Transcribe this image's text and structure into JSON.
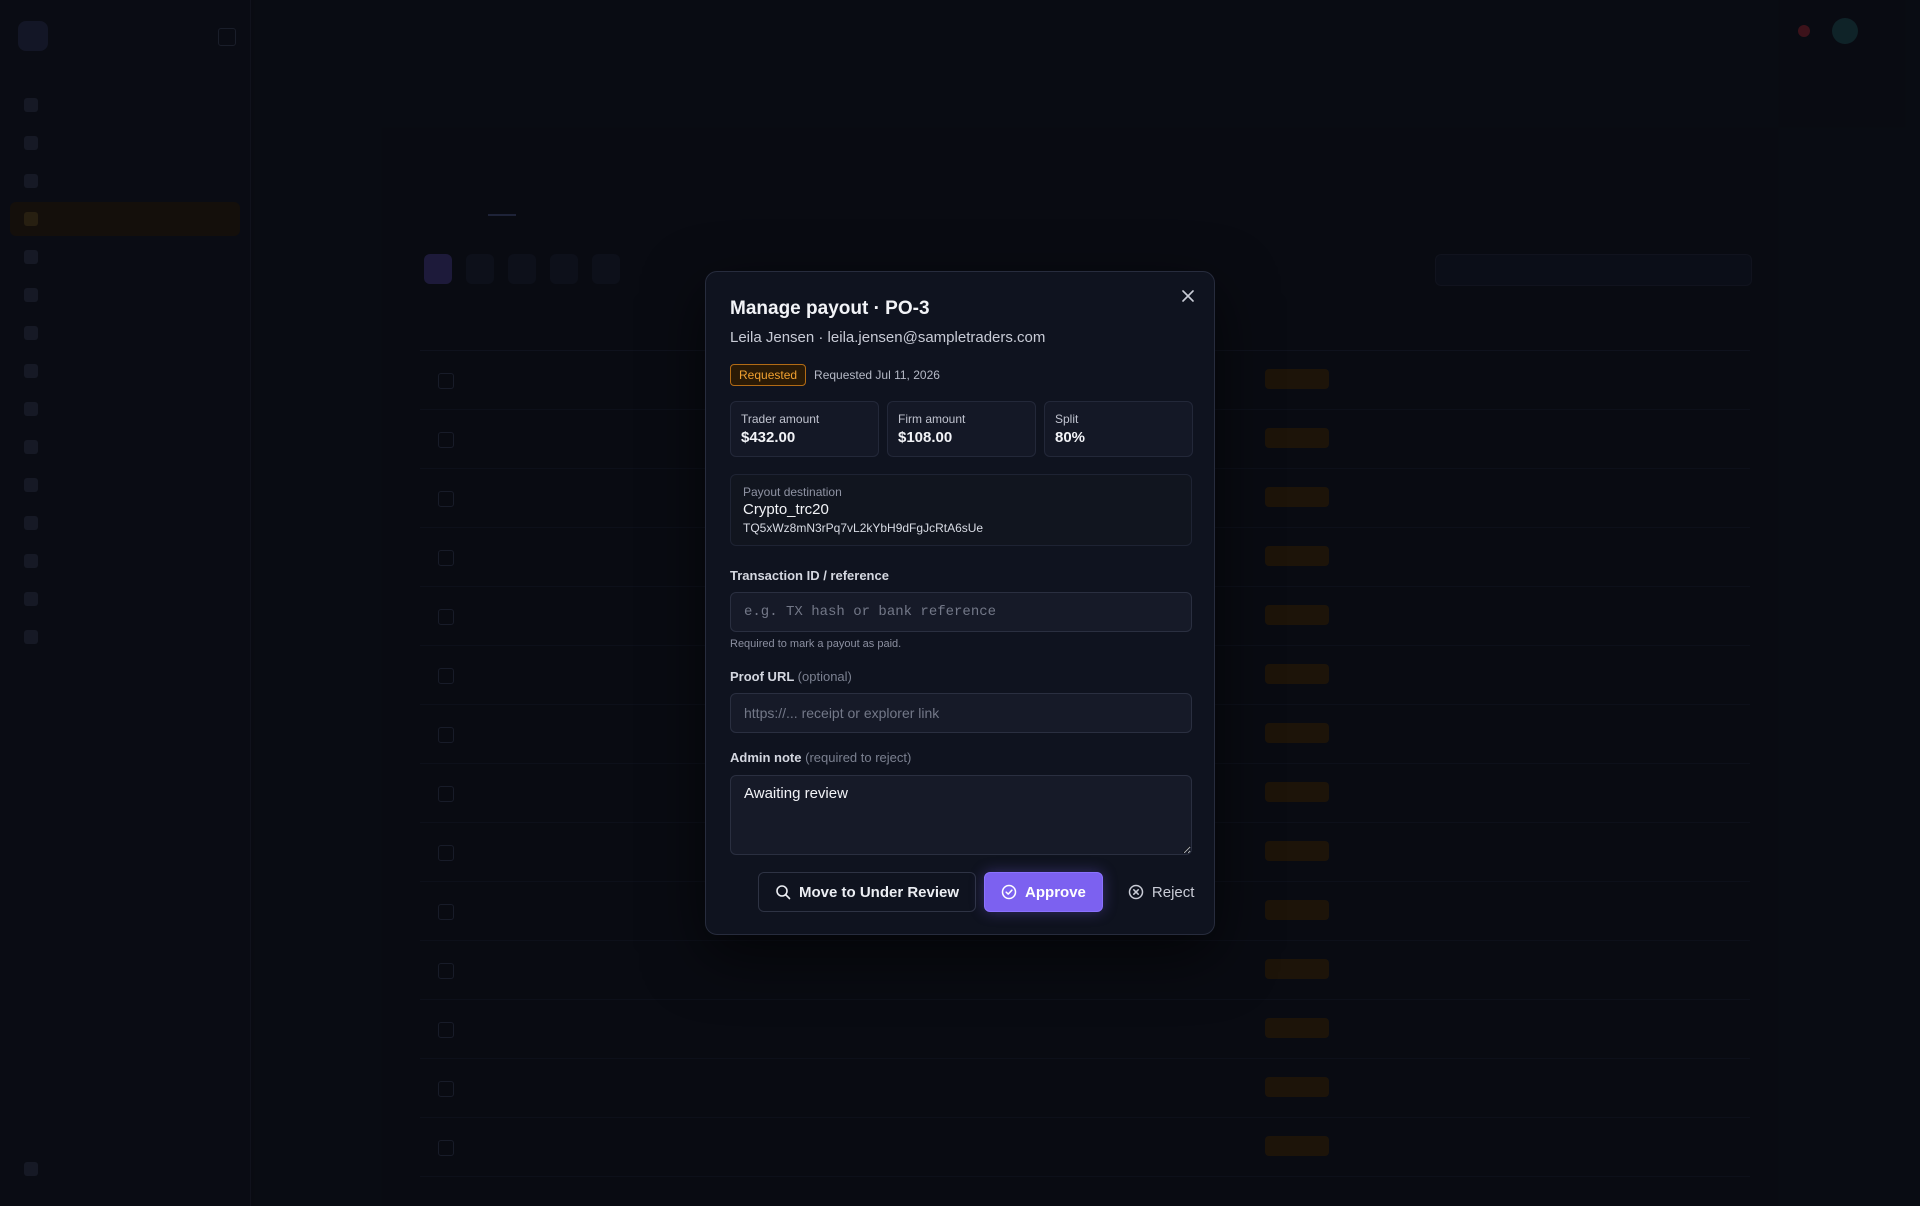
{
  "modal": {
    "title": "Manage payout · PO-3",
    "subtitle": "Leila Jensen · leila.jensen@sampletraders.com",
    "status_badge": "Requested",
    "requested_date": "Requested Jul 11, 2026",
    "stats": [
      {
        "label": "Trader amount",
        "value": "$432.00"
      },
      {
        "label": "Firm amount",
        "value": "$108.00"
      },
      {
        "label": "Split",
        "value": "80%"
      }
    ],
    "destination": {
      "label": "Payout destination",
      "method": "Crypto_trc20",
      "address": "TQ5xWz8mN3rPq7vL2kYbH9dFgJcRtA6sUe"
    },
    "transaction": {
      "label": "Transaction ID / reference",
      "placeholder": "e.g. TX hash or bank reference",
      "help": "Required to mark a payout as paid."
    },
    "proof": {
      "label": "Proof URL",
      "optional": "(optional)",
      "placeholder": "https://... receipt or explorer link"
    },
    "note": {
      "label": "Admin note",
      "hint": "(required to reject)",
      "value": "Awaiting review"
    },
    "buttons": {
      "review": "Move to Under Review",
      "approve": "Approve",
      "reject": "Reject"
    }
  },
  "icons": [
    "close-icon",
    "search-icon",
    "check-circle-icon",
    "x-circle-icon"
  ],
  "colors": {
    "accent": "#7c61f0",
    "status_requested": "#f0a030",
    "background": "#0b0e16"
  }
}
